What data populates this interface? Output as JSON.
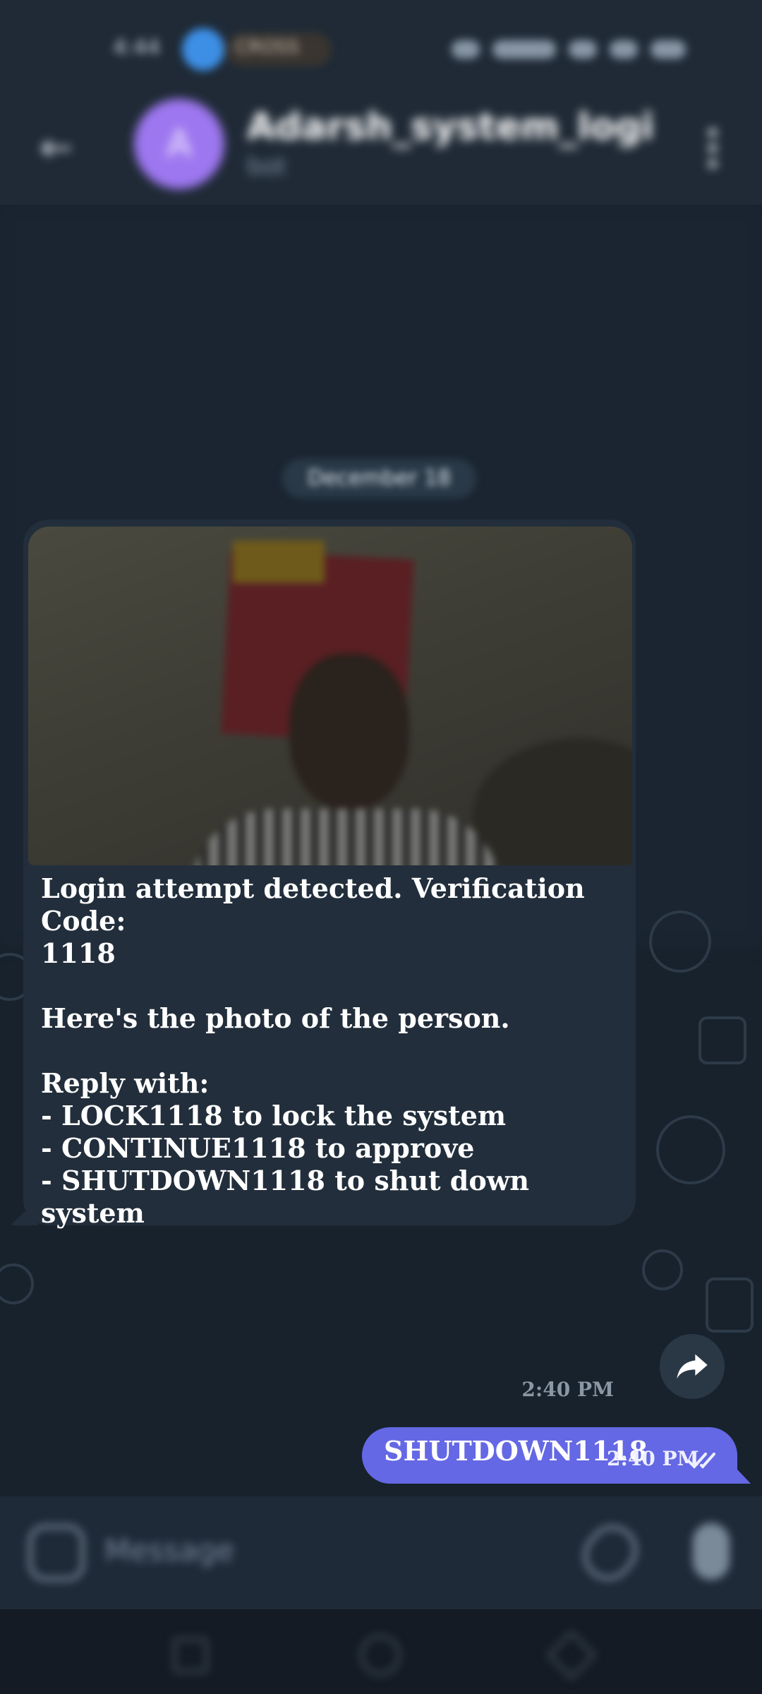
{
  "status_bar": {
    "time": "4:44",
    "app_pill_label": "CROSS"
  },
  "header": {
    "chat_title": "Adarsh_system_login_i",
    "chat_subtitle": "bot",
    "avatar_letter": "A"
  },
  "chat": {
    "date_chip": "December 18",
    "incoming": {
      "text": "Login attempt detected. Verification Code:\n1118\n\nHere's the photo of the person.\n\nReply with:\n- LOCK1118 to lock the system\n- CONTINUE1118 to approve\n- SHUTDOWN1118 to shut down system",
      "time": "2:40 PM"
    },
    "outgoing": {
      "text": "SHUTDOWN1118",
      "time": "2:40 PM"
    }
  },
  "input": {
    "placeholder": "Message"
  },
  "colors": {
    "outgoing_bubble": "#6468e4",
    "incoming_bubble": "#222e3b",
    "background": "#17212b",
    "avatar": "#9d77f0"
  },
  "icons": [
    "back-arrow-icon",
    "more-vert-icon",
    "forward-icon",
    "double-check-icon",
    "emoji-icon",
    "attach-icon",
    "mic-icon"
  ]
}
